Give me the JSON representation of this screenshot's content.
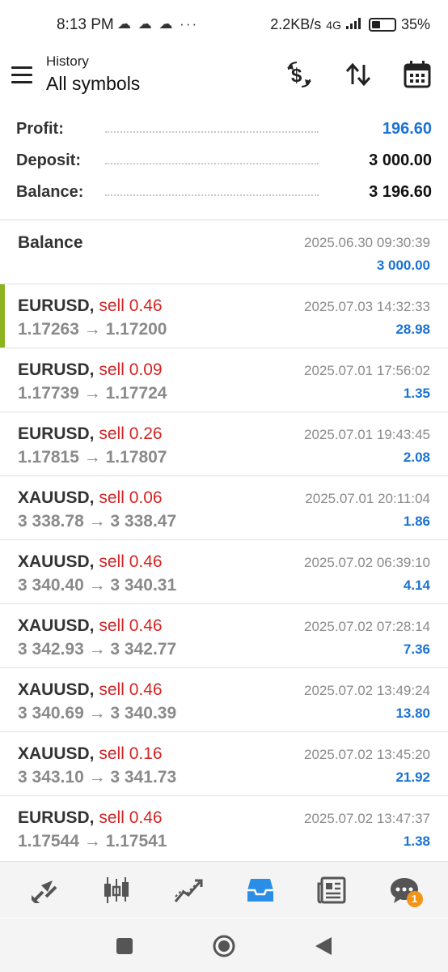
{
  "status_bar": {
    "time": "8:13 PM",
    "left_icons": "☁ ☁ ☁  ···",
    "network_speed": "2.2KB/s",
    "network_type": "4G",
    "battery": "35%"
  },
  "header": {
    "subtitle": "History",
    "title": "All symbols",
    "icons": [
      "menu-icon",
      "currency-exchange-icon",
      "sort-icon",
      "calendar-icon"
    ]
  },
  "summary": {
    "profit_label": "Profit:",
    "profit_value": "196.60",
    "deposit_label": "Deposit:",
    "deposit_value": "3 000.00",
    "balance_label": "Balance:",
    "balance_value": "3 196.60"
  },
  "balance_entry": {
    "title": "Balance",
    "datetime": "2025.06.30 09:30:39",
    "amount": "3 000.00"
  },
  "deals": [
    {
      "symbol": "EURUSD,",
      "side": "sell 0.46",
      "prices": "1.17263 → 1.17200",
      "datetime": "2025.07.03 14:32:33",
      "profit": "28.98"
    },
    {
      "symbol": "EURUSD,",
      "side": "sell 0.09",
      "prices": "1.17739 → 1.17724",
      "datetime": "2025.07.01 17:56:02",
      "profit": "1.35"
    },
    {
      "symbol": "EURUSD,",
      "side": "sell 0.26",
      "prices": "1.17815 → 1.17807",
      "datetime": "2025.07.01 19:43:45",
      "profit": "2.08"
    },
    {
      "symbol": "XAUUSD,",
      "side": "sell 0.06",
      "prices": "3 338.78 → 3 338.47",
      "datetime": "2025.07.01 20:11:04",
      "profit": "1.86"
    },
    {
      "symbol": "XAUUSD,",
      "side": "sell 0.46",
      "prices": "3 340.40 → 3 340.31",
      "datetime": "2025.07.02 06:39:10",
      "profit": "4.14"
    },
    {
      "symbol": "XAUUSD,",
      "side": "sell 0.46",
      "prices": "3 342.93 → 3 342.77",
      "datetime": "2025.07.02 07:28:14",
      "profit": "7.36"
    },
    {
      "symbol": "XAUUSD,",
      "side": "sell 0.46",
      "prices": "3 340.69 → 3 340.39",
      "datetime": "2025.07.02 13:49:24",
      "profit": "13.80"
    },
    {
      "symbol": "XAUUSD,",
      "side": "sell 0.16",
      "prices": "3 343.10 → 3 341.73",
      "datetime": "2025.07.02 13:45:20",
      "profit": "21.92"
    },
    {
      "symbol": "EURUSD,",
      "side": "sell 0.46",
      "prices": "1.17544 → 1.17541",
      "datetime": "2025.07.02 13:47:37",
      "profit": "1.38"
    }
  ],
  "bottom_nav": {
    "items": [
      "quotes-icon",
      "chart-icon",
      "trade-icon",
      "history-icon",
      "news-icon",
      "chat-icon"
    ],
    "active": "history-icon",
    "chat_badge": "1"
  },
  "system_nav": [
    "recents-button",
    "home-button",
    "back-button"
  ],
  "colors": {
    "accent_blue": "#1a73d4",
    "sell_red": "#d32424",
    "highlight_green": "#8bb31d",
    "badge_orange": "#f29418"
  }
}
